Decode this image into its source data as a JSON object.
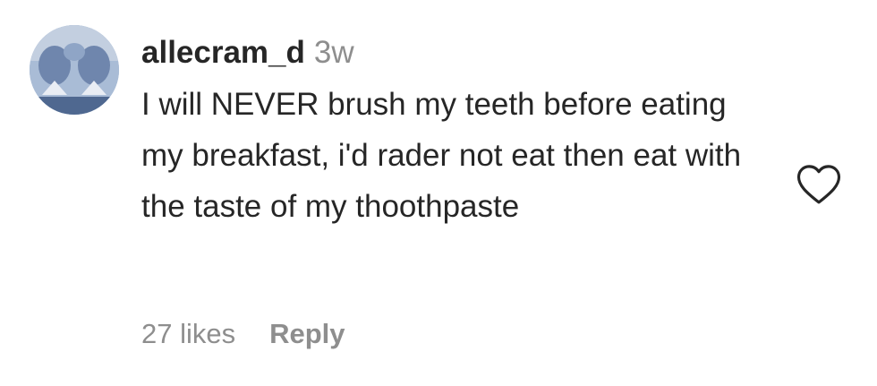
{
  "comment": {
    "username": "allecram_d",
    "time": "3w",
    "text": "I will NEVER brush my teeth before eating my breakfast, i'd rader not eat then eat with the taste of my thoothpaste",
    "likes_label": "27 likes",
    "reply_label": "Reply",
    "like_icon": "heart-outline-icon",
    "avatar_icon": "user-avatar"
  },
  "colors": {
    "text": "#262626",
    "secondary": "#8e8e8e"
  }
}
